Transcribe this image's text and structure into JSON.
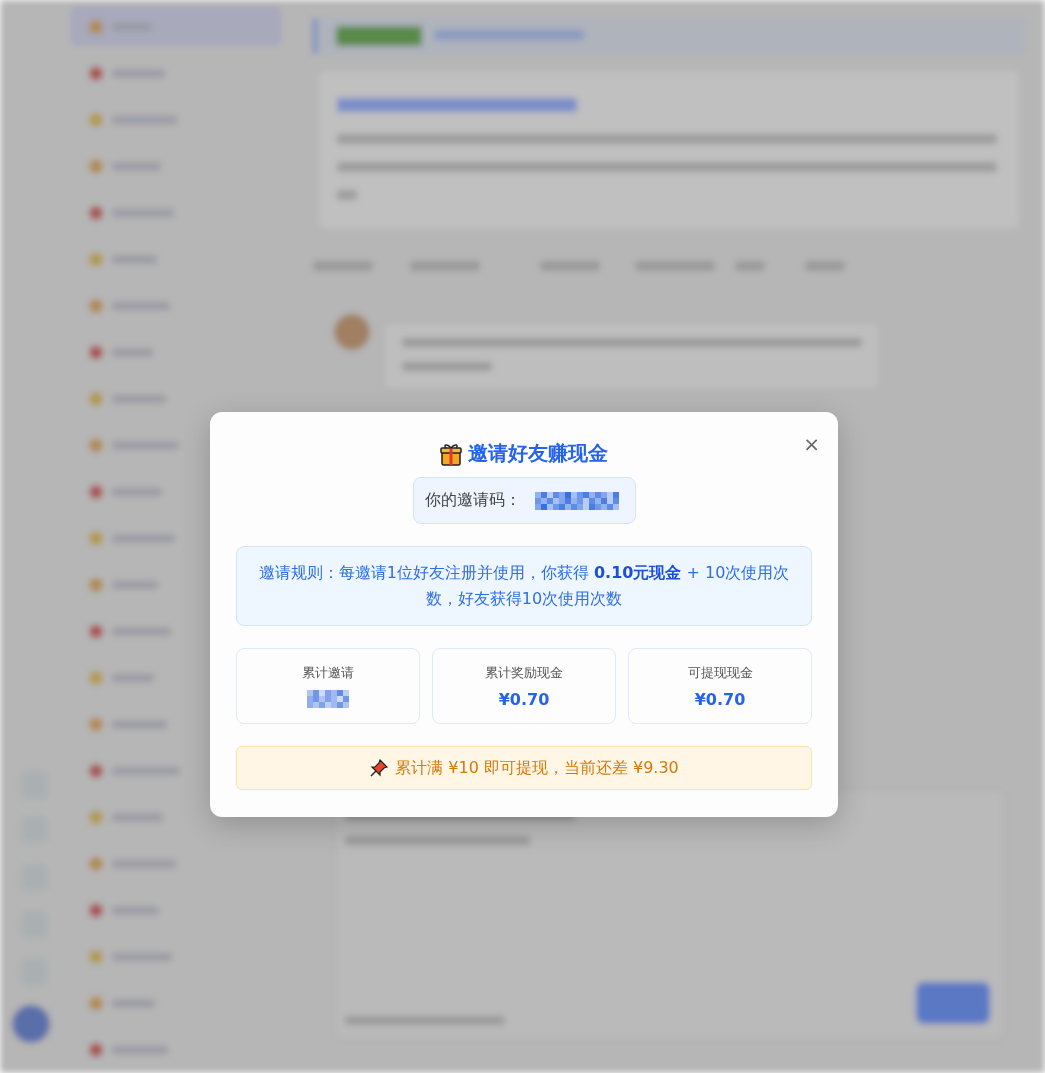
{
  "dialog": {
    "title": "邀请好友赚现金",
    "close": "×",
    "invite_code": {
      "label": "你的邀请码：",
      "redacted": true
    },
    "rules": "邀请规则：每邀请1位好友注册并使用，你获得 **0.10元现金** + 10次使用次数，好友获得10次使用次数",
    "stats": [
      {
        "label": "累计邀请",
        "redacted": true
      },
      {
        "label": "累计奖励现金",
        "value": "¥0.70",
        "redacted": false
      },
      {
        "label": "可提现现金",
        "value": "¥0.70",
        "redacted": false
      }
    ],
    "notice": "累计满 ¥10 即可提现，当前还差 ¥9.30"
  }
}
